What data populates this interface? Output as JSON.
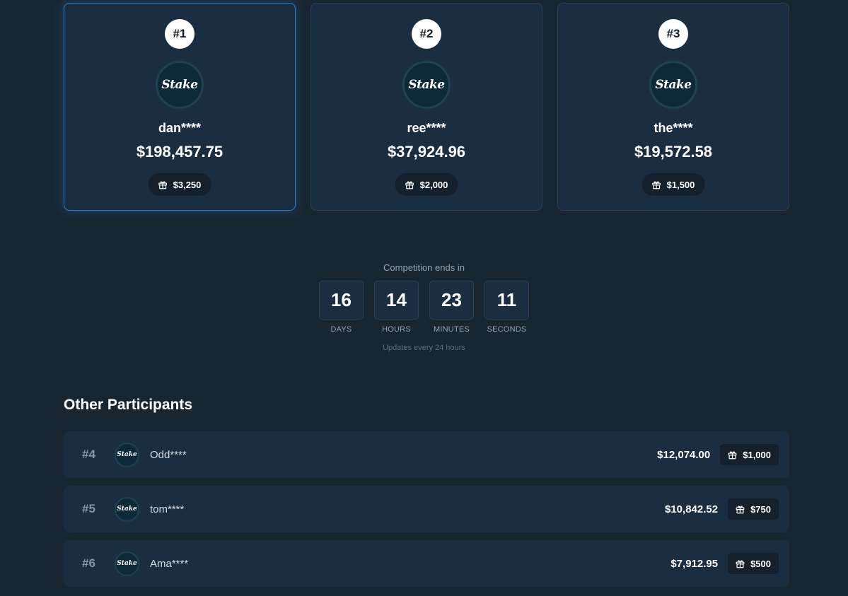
{
  "podium": [
    {
      "rank": "#1",
      "logo": "Stake",
      "name": "dan****",
      "amount": "$198,457.75",
      "prize": "$3,250"
    },
    {
      "rank": "#2",
      "logo": "Stake",
      "name": "ree****",
      "amount": "$37,924.96",
      "prize": "$2,000"
    },
    {
      "rank": "#3",
      "logo": "Stake",
      "name": "the****",
      "amount": "$19,572.58",
      "prize": "$1,500"
    }
  ],
  "countdown": {
    "label": "Competition ends in",
    "days": "16",
    "days_label": "DAYS",
    "hours": "14",
    "hours_label": "HOURS",
    "minutes": "23",
    "minutes_label": "MINUTES",
    "seconds": "11",
    "seconds_label": "SECONDS",
    "note": "Updates every 24 hours"
  },
  "others": {
    "title": "Other Participants",
    "rows": [
      {
        "rank": "#4",
        "logo": "Stake",
        "name": "Odd****",
        "amount": "$12,074.00",
        "prize": "$1,000"
      },
      {
        "rank": "#5",
        "logo": "Stake",
        "name": "tom****",
        "amount": "$10,842.52",
        "prize": "$750"
      },
      {
        "rank": "#6",
        "logo": "Stake",
        "name": "Ama****",
        "amount": "$7,912.95",
        "prize": "$500"
      }
    ]
  },
  "icons": {
    "gift": "gift-icon",
    "logo": "stake-logo"
  },
  "colors": {
    "background": "#182632",
    "card": "#1b2e41",
    "highlight_border": "#2f7fd0",
    "badge": "#ffffff"
  }
}
